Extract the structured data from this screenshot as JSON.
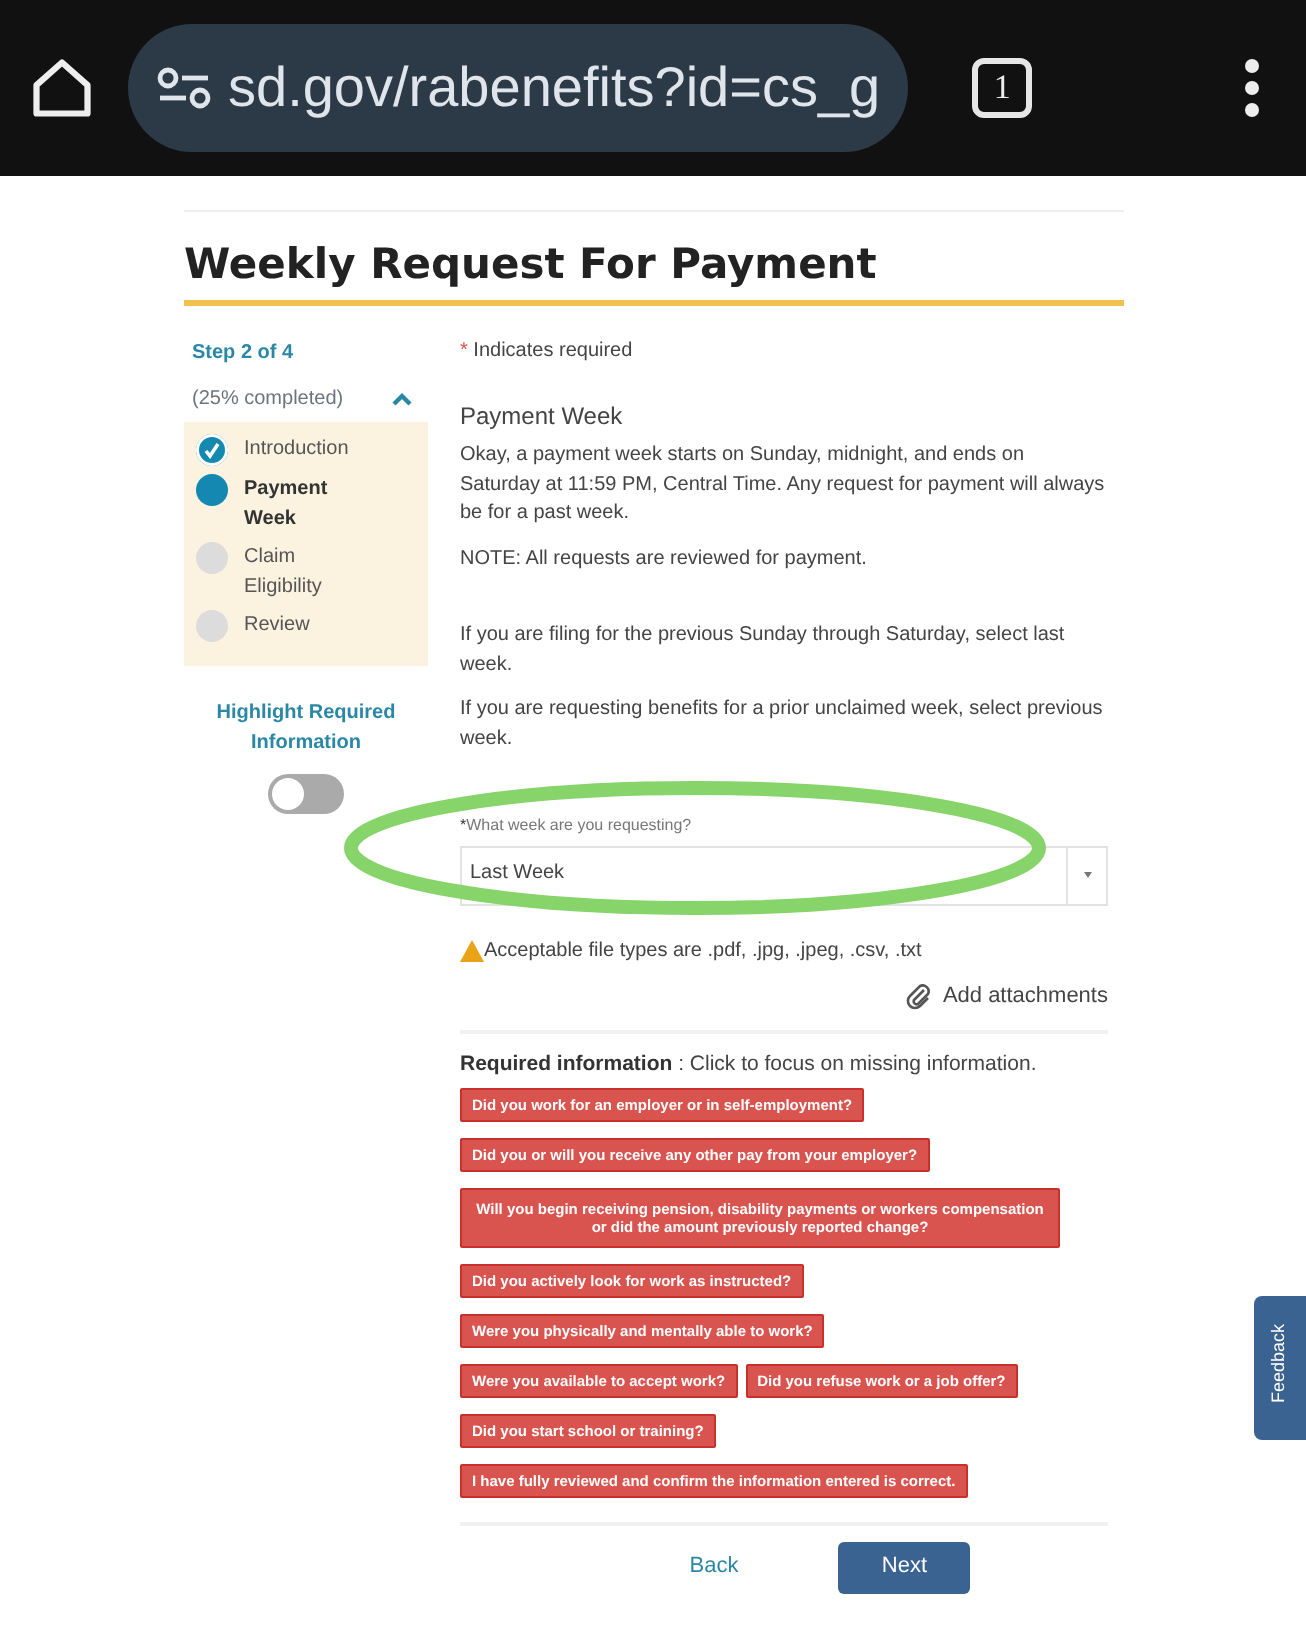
{
  "browser": {
    "url": "sd.gov/rabenefits?id=cs_g",
    "tab_count": "1"
  },
  "title": "Weekly Request For Payment",
  "progress": {
    "step": "Step 2 of 4",
    "completed": "(25% completed)",
    "expanded": true,
    "steps": [
      {
        "label": "Introduction",
        "done": true,
        "selected": false
      },
      {
        "label": "Payment Week",
        "done": false,
        "selected": true
      },
      {
        "label": "Claim Eligibility",
        "done": false,
        "selected": false
      },
      {
        "label": "Review",
        "done": false,
        "selected": false
      }
    ]
  },
  "highlight_toggle": {
    "label": "Highlight Required Information",
    "on": false
  },
  "required_note": {
    "mark": "*",
    "text": "Indicates required"
  },
  "section_title": "Payment Week",
  "paragraphs": [
    "Okay, a payment week starts on Sunday, midnight, and ends on Saturday at 11:59 PM, Central Time. Any request for payment will always be for a past week.",
    "NOTE: All requests are reviewed for payment."
  ],
  "instructions": [
    "If you are filing for the previous Sunday through Saturday, select last week.",
    "If you are requesting benefits for a prior unclaimed week, select previous week."
  ],
  "week_select": {
    "required_mark": "*",
    "label": "What week are you requesting?",
    "value": "Last Week"
  },
  "file_types_warning": "Acceptable file types are .pdf, .jpg, .jpeg, .csv, .txt",
  "attach_link": "Add attachments",
  "required_info": {
    "heading": "Required information",
    "hint": " : Click to focus on missing information.",
    "items": [
      "Did you work for an employer or in self-employment?",
      "Did you or will you receive any other pay from your employer?",
      "Will you begin receiving pension, disability payments or workers compensation or did the amount previously reported change?",
      "Did you actively look for work as instructed?",
      "Were you physically and mentally able to work?",
      "Were you available to accept work?",
      "Did you refuse work or a job offer?",
      "Did you start school or training?",
      "I have fully reviewed and confirm the information entered is correct."
    ]
  },
  "buttons": [
    {
      "label": "Back",
      "kind": "link"
    },
    {
      "label": "Next",
      "kind": "primary"
    }
  ],
  "feedback_tab": "Feedback"
}
